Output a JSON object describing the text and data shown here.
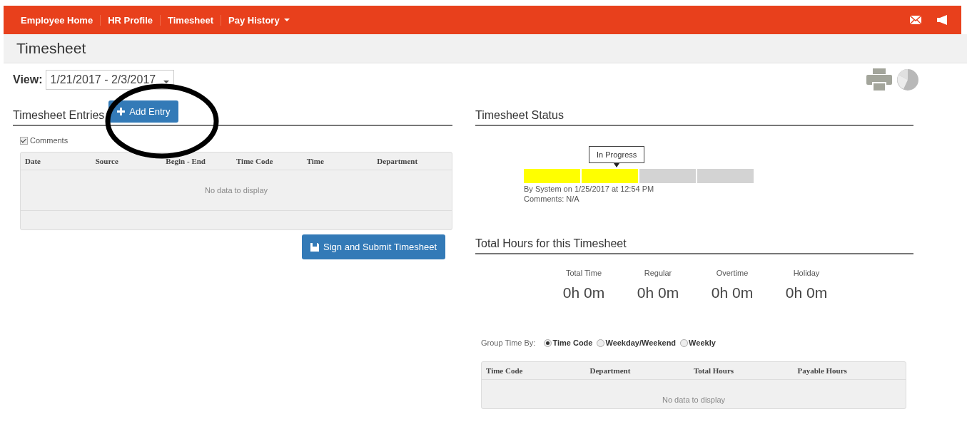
{
  "nav": {
    "items": [
      {
        "label": "Employee Home",
        "dropdown": false
      },
      {
        "label": "HR Profile",
        "dropdown": false
      },
      {
        "label": "Timesheet",
        "dropdown": false
      },
      {
        "label": "Pay History",
        "dropdown": true
      }
    ]
  },
  "page_title": "Timesheet",
  "view": {
    "label": "View:",
    "value": "1/21/2017 - 2/3/2017"
  },
  "entries": {
    "heading": "Timesheet Entries",
    "add_button": "Add Entry",
    "comments": {
      "label": "Comments",
      "checked": true
    },
    "columns": [
      "Date",
      "Source",
      "Begin - End",
      "Time Code",
      "Time",
      "Department"
    ],
    "empty_text": "No data to display",
    "submit_button": "Sign and Submit Timesheet"
  },
  "status": {
    "heading": "Timesheet Status",
    "callout": "In Progress",
    "segments": [
      {
        "done": true
      },
      {
        "done": true
      },
      {
        "done": false
      },
      {
        "done": false
      }
    ],
    "by_line": "By System on 1/25/2017 at 12:54 PM",
    "comments": "Comments: N/A"
  },
  "totals": {
    "heading": "Total Hours for this Timesheet",
    "items": [
      {
        "label": "Total Time",
        "value": "0h 0m"
      },
      {
        "label": "Regular",
        "value": "0h 0m"
      },
      {
        "label": "Overtime",
        "value": "0h 0m"
      },
      {
        "label": "Holiday",
        "value": "0h 0m"
      }
    ]
  },
  "group_by": {
    "label": "Group Time By:",
    "options": [
      {
        "label": "Time Code",
        "selected": true
      },
      {
        "label": "Weekday/Weekend",
        "selected": false
      },
      {
        "label": "Weekly",
        "selected": false
      }
    ]
  },
  "summary": {
    "columns": [
      "Time Code",
      "Department",
      "Total Hours",
      "Payable Hours"
    ],
    "empty_text": "No data to display"
  }
}
